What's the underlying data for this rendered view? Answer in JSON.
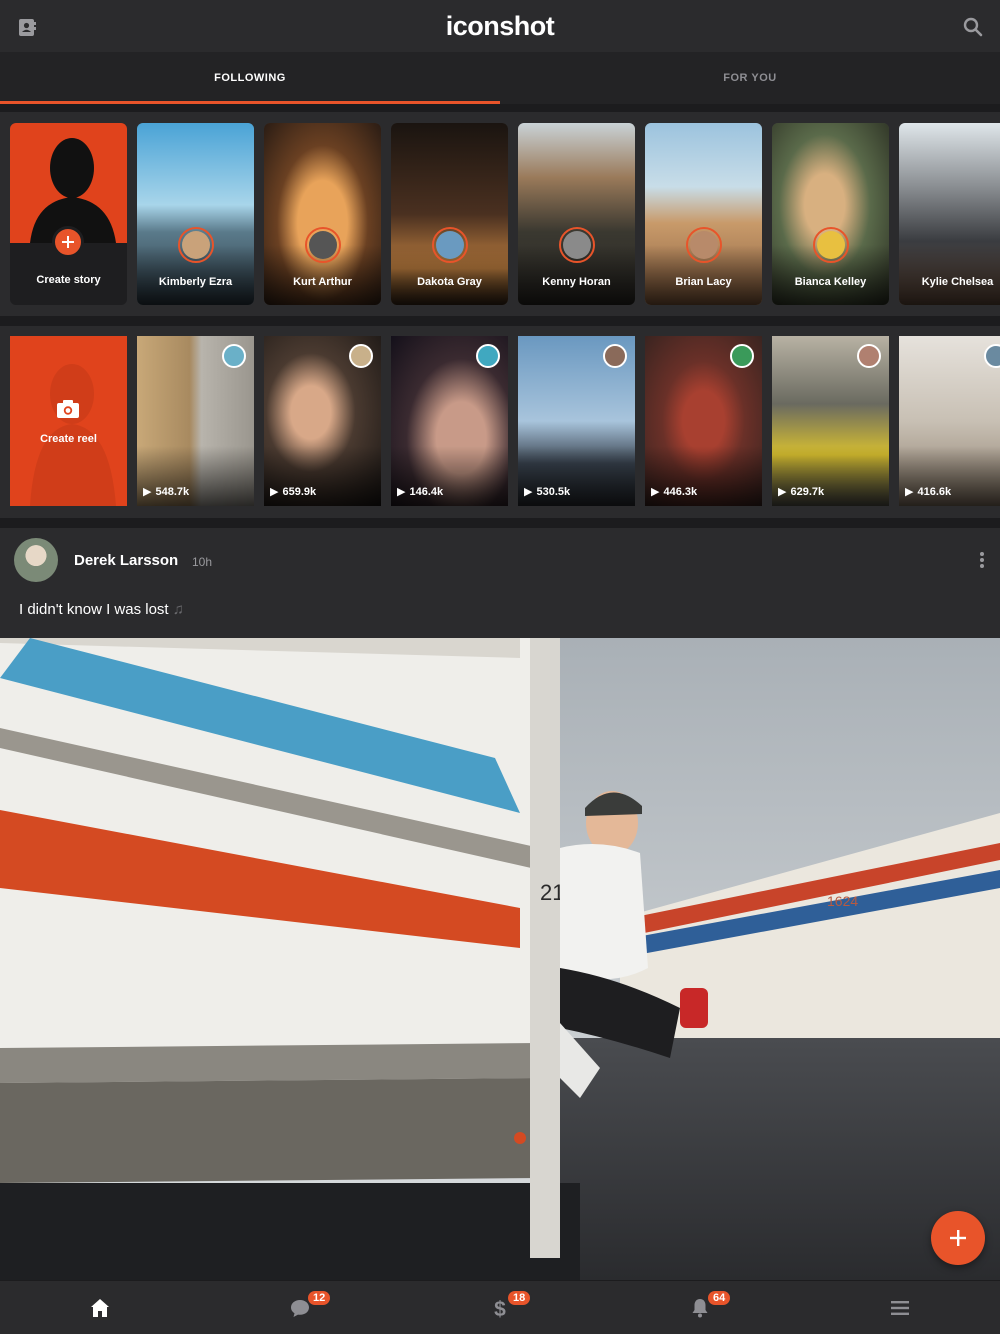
{
  "app": {
    "title": "iconshot"
  },
  "tabs": [
    {
      "label": "FOLLOWING",
      "active": true
    },
    {
      "label": "FOR YOU",
      "active": false
    }
  ],
  "stories": {
    "create_label": "Create story",
    "items": [
      {
        "name": "Kimberly Ezra"
      },
      {
        "name": "Kurt Arthur"
      },
      {
        "name": "Dakota Gray"
      },
      {
        "name": "Kenny Horan"
      },
      {
        "name": "Brian Lacy"
      },
      {
        "name": "Bianca Kelley"
      },
      {
        "name": "Kylie Chelsea"
      }
    ]
  },
  "reels": {
    "create_label": "Create reel",
    "items": [
      {
        "plays": "548.7k"
      },
      {
        "plays": "659.9k"
      },
      {
        "plays": "146.4k"
      },
      {
        "plays": "530.5k"
      },
      {
        "plays": "446.3k"
      },
      {
        "plays": "629.7k"
      },
      {
        "plays": "416.6k"
      }
    ]
  },
  "post": {
    "author": "Derek Larsson",
    "time": "10h",
    "caption": "I didn't know I was lost",
    "truck_number": "21",
    "building_number": "1624"
  },
  "bottom_nav": {
    "messages_badge": "12",
    "money_badge": "18",
    "notifications_badge": "64"
  },
  "colors": {
    "accent": "#e8542a",
    "background": "#2b2b2d"
  }
}
